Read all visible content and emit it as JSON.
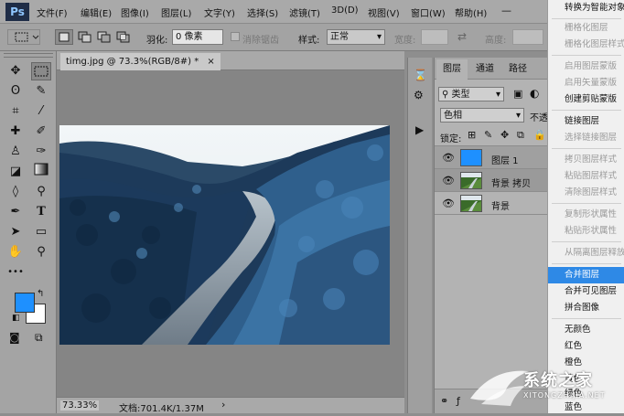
{
  "app": {
    "logo": "Ps"
  },
  "menu": [
    "文件(F)",
    "编辑(E)",
    "图像(I)",
    "图层(L)",
    "文字(Y)",
    "选择(S)",
    "滤镜(T)",
    "3D(D)",
    "视图(V)",
    "窗口(W)",
    "帮助(H)"
  ],
  "options": {
    "feather_label": "羽化:",
    "feather_value": "0 像素",
    "antialias_label": "消除锯齿",
    "style_label": "样式:",
    "style_value": "正常",
    "width_label": "宽度:",
    "height_label": "高度:"
  },
  "document": {
    "tab_title": "timg.jpg @ 73.3%(RGB/8#) *",
    "zoom": "73.33%",
    "doc_size": "文档:701.4K/1.37M"
  },
  "layers_panel": {
    "tabs": [
      "图层",
      "通道",
      "路径"
    ],
    "filter_label": "类型",
    "blend_mode": "色相",
    "opacity_label": "不透",
    "lock_label": "锁定:",
    "layers": [
      {
        "name": "图层 1",
        "kind": "blue"
      },
      {
        "name": "背景 拷贝",
        "kind": "photo"
      },
      {
        "name": "背景",
        "kind": "photo"
      }
    ]
  },
  "context_menu": {
    "items": [
      {
        "label": "转换为智能对象",
        "state": "normal"
      },
      {
        "label": "栅格化图层",
        "state": "disabled"
      },
      {
        "label": "栅格化图层样式",
        "state": "disabled"
      },
      {
        "label": "启用图层蒙版",
        "state": "disabled"
      },
      {
        "label": "启用矢量蒙版",
        "state": "disabled"
      },
      {
        "label": "创建剪贴蒙版",
        "state": "normal"
      },
      {
        "label": "链接图层",
        "state": "normal"
      },
      {
        "label": "选择链接图层",
        "state": "disabled"
      },
      {
        "label": "拷贝图层样式",
        "state": "disabled"
      },
      {
        "label": "粘贴图层样式",
        "state": "disabled"
      },
      {
        "label": "清除图层样式",
        "state": "disabled"
      },
      {
        "label": "复制形状属性",
        "state": "disabled"
      },
      {
        "label": "粘贴形状属性",
        "state": "disabled"
      },
      {
        "label": "从隔离图层释放",
        "state": "disabled"
      },
      {
        "label": "合并图层",
        "state": "highlighted"
      },
      {
        "label": "合并可见图层",
        "state": "normal"
      },
      {
        "label": "拼合图像",
        "state": "normal"
      },
      {
        "label": "无颜色",
        "state": "normal"
      },
      {
        "label": "红色",
        "state": "normal"
      },
      {
        "label": "橙色",
        "state": "normal"
      },
      {
        "label": "黄色",
        "state": "normal"
      },
      {
        "label": "绿色",
        "state": "normal"
      },
      {
        "label": "蓝色",
        "state": "normal"
      }
    ]
  },
  "watermark": {
    "title": "系统之家",
    "url": "XITONGZHIJIA.NET"
  },
  "colors": {
    "foreground": "#1e90ff",
    "background": "#ffffff",
    "highlight": "#2e89e6"
  }
}
